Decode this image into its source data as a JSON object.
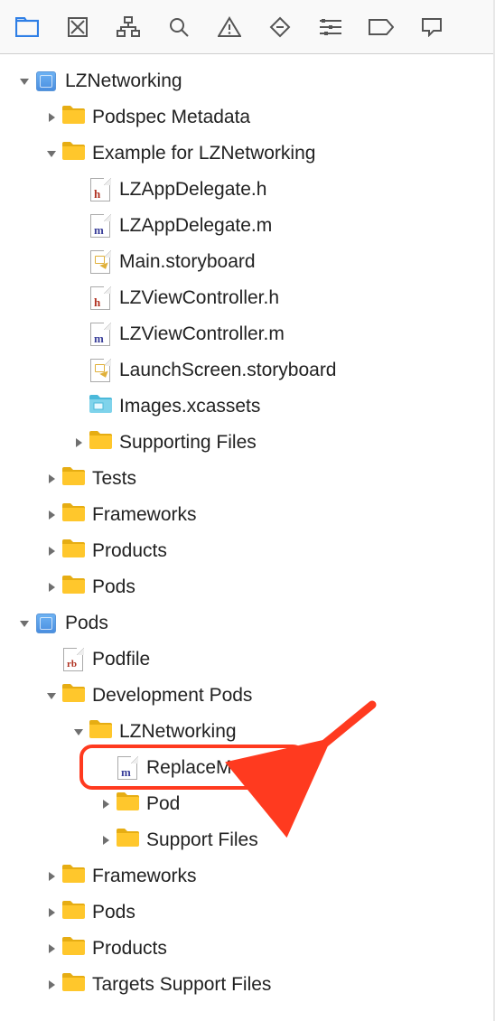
{
  "toolbar": {
    "icons": [
      "folder",
      "box-x",
      "hierarchy",
      "search",
      "warnings",
      "diamond",
      "list",
      "tag",
      "comment"
    ]
  },
  "tree": [
    {
      "depth": 0,
      "disc": "down",
      "icon": "proj",
      "label": "LZNetworking"
    },
    {
      "depth": 1,
      "disc": "right",
      "icon": "folder",
      "label": "Podspec Metadata"
    },
    {
      "depth": 1,
      "disc": "down",
      "icon": "folder",
      "label": "Example for LZNetworking"
    },
    {
      "depth": 2,
      "disc": "none",
      "icon": "h",
      "label": "LZAppDelegate.h"
    },
    {
      "depth": 2,
      "disc": "none",
      "icon": "m",
      "label": "LZAppDelegate.m"
    },
    {
      "depth": 2,
      "disc": "none",
      "icon": "sb",
      "label": "Main.storyboard"
    },
    {
      "depth": 2,
      "disc": "none",
      "icon": "h",
      "label": "LZViewController.h"
    },
    {
      "depth": 2,
      "disc": "none",
      "icon": "m",
      "label": "LZViewController.m"
    },
    {
      "depth": 2,
      "disc": "none",
      "icon": "sb",
      "label": "LaunchScreen.storyboard"
    },
    {
      "depth": 2,
      "disc": "none",
      "icon": "assets",
      "label": "Images.xcassets"
    },
    {
      "depth": 2,
      "disc": "right",
      "icon": "folder",
      "label": "Supporting Files"
    },
    {
      "depth": 1,
      "disc": "right",
      "icon": "folder",
      "label": "Tests"
    },
    {
      "depth": 1,
      "disc": "right",
      "icon": "folder",
      "label": "Frameworks"
    },
    {
      "depth": 1,
      "disc": "right",
      "icon": "folder",
      "label": "Products"
    },
    {
      "depth": 1,
      "disc": "right",
      "icon": "folder",
      "label": "Pods"
    },
    {
      "depth": 0,
      "disc": "down",
      "icon": "proj",
      "label": "Pods"
    },
    {
      "depth": 1,
      "disc": "none",
      "icon": "rb",
      "label": "Podfile"
    },
    {
      "depth": 1,
      "disc": "down",
      "icon": "folder",
      "label": "Development Pods"
    },
    {
      "depth": 2,
      "disc": "down",
      "icon": "folder",
      "label": "LZNetworking"
    },
    {
      "depth": 3,
      "disc": "none",
      "icon": "m",
      "label": "ReplaceMe.m",
      "highlight": true
    },
    {
      "depth": 3,
      "disc": "right",
      "icon": "folder",
      "label": "Pod"
    },
    {
      "depth": 3,
      "disc": "right",
      "icon": "folder",
      "label": "Support Files"
    },
    {
      "depth": 1,
      "disc": "right",
      "icon": "folder",
      "label": "Frameworks"
    },
    {
      "depth": 1,
      "disc": "right",
      "icon": "folder",
      "label": "Pods"
    },
    {
      "depth": 1,
      "disc": "right",
      "icon": "folder",
      "label": "Products"
    },
    {
      "depth": 1,
      "disc": "right",
      "icon": "folder",
      "label": "Targets Support Files"
    }
  ],
  "annotation": {
    "has_arrow": true
  }
}
